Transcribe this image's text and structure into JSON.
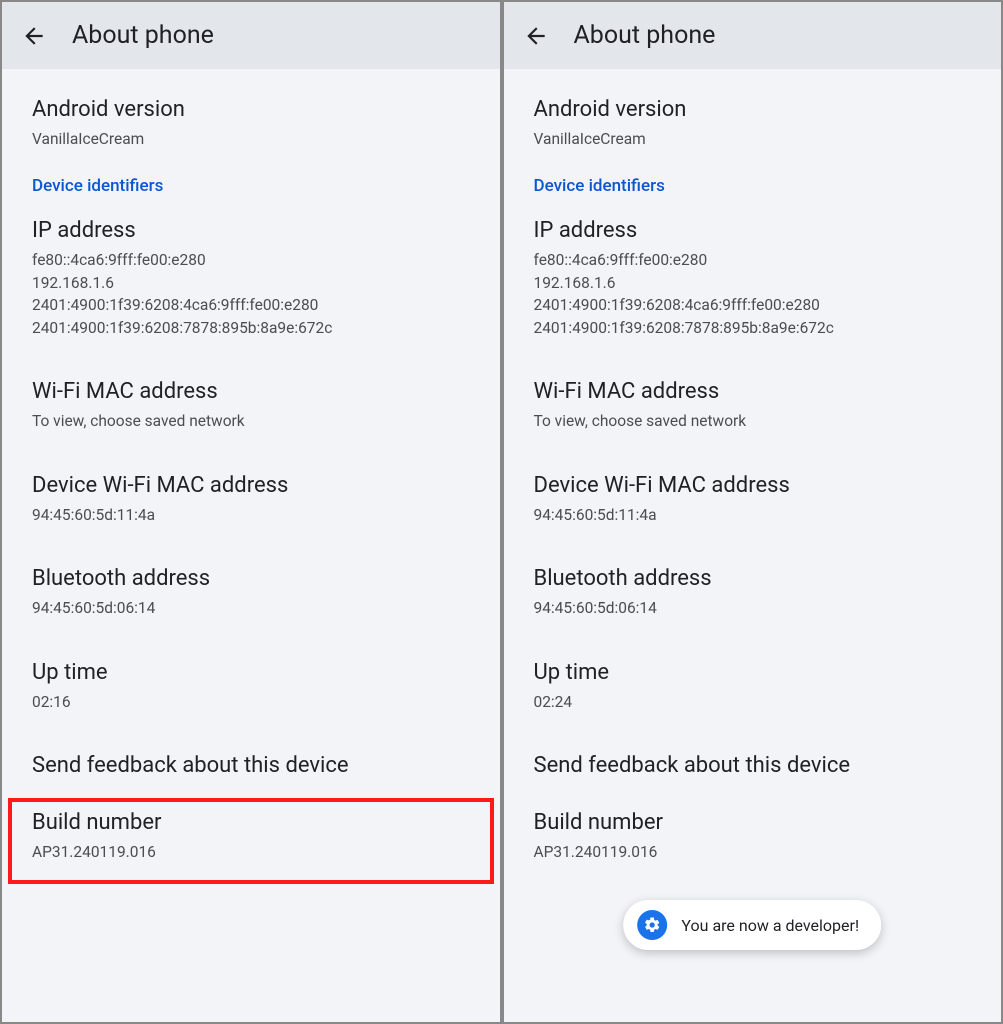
{
  "left": {
    "header": {
      "title": "About phone"
    },
    "android_version": {
      "title": "Android version",
      "value": "VanillaIceCream"
    },
    "section": "Device identifiers",
    "ip": {
      "title": "IP address",
      "value": "fe80::4ca6:9fff:fe00:e280\n192.168.1.6\n2401:4900:1f39:6208:4ca6:9fff:fe00:e280\n2401:4900:1f39:6208:7878:895b:8a9e:672c"
    },
    "wifi_mac": {
      "title": "Wi-Fi MAC address",
      "value": "To view, choose saved network"
    },
    "device_wifi_mac": {
      "title": "Device Wi-Fi MAC address",
      "value": "94:45:60:5d:11:4a"
    },
    "bt": {
      "title": "Bluetooth address",
      "value": "94:45:60:5d:06:14"
    },
    "uptime": {
      "title": "Up time",
      "value": "02:16"
    },
    "feedback": "Send feedback about this device",
    "build": {
      "title": "Build number",
      "value": "AP31.240119.016"
    }
  },
  "right": {
    "header": {
      "title": "About phone"
    },
    "android_version": {
      "title": "Android version",
      "value": "VanillaIceCream"
    },
    "section": "Device identifiers",
    "ip": {
      "title": "IP address",
      "value": "fe80::4ca6:9fff:fe00:e280\n192.168.1.6\n2401:4900:1f39:6208:4ca6:9fff:fe00:e280\n2401:4900:1f39:6208:7878:895b:8a9e:672c"
    },
    "wifi_mac": {
      "title": "Wi-Fi MAC address",
      "value": "To view, choose saved network"
    },
    "device_wifi_mac": {
      "title": "Device Wi-Fi MAC address",
      "value": "94:45:60:5d:11:4a"
    },
    "bt": {
      "title": "Bluetooth address",
      "value": "94:45:60:5d:06:14"
    },
    "uptime": {
      "title": "Up time",
      "value": "02:24"
    },
    "feedback": "Send feedback about this device",
    "build": {
      "title": "Build number",
      "value": "AP31.240119.016"
    },
    "toast": "You are now a developer!"
  }
}
